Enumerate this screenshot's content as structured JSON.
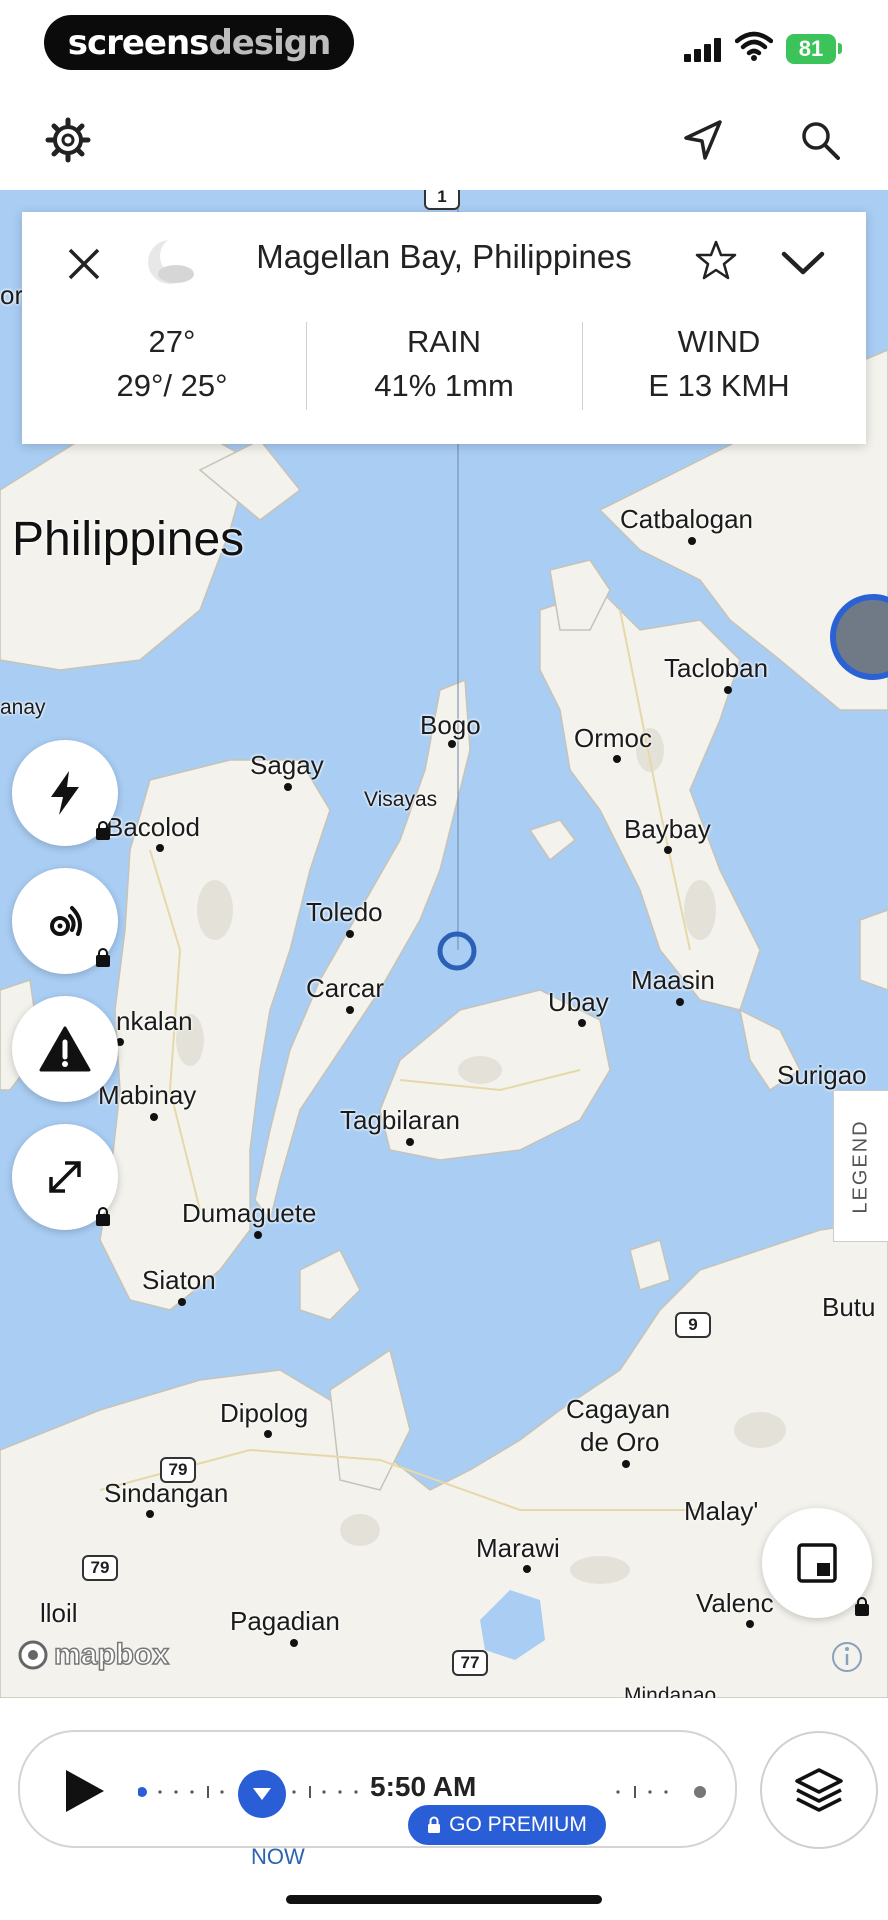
{
  "status_bar": {
    "brand_part1": "screens",
    "brand_part2": "design",
    "battery": "81"
  },
  "header": {
    "settings_icon": "gear-icon",
    "location_icon": "navigation-arrow-icon",
    "search_icon": "search-icon"
  },
  "card": {
    "title": "Magellan Bay, Philippines",
    "temp_current": "27°",
    "temp_range": "29°/ 25°",
    "rain_label": "RAIN",
    "rain_value": "41% 1mm",
    "wind_label": "WIND",
    "wind_value": "E 13 KMH"
  },
  "map": {
    "country_label": "Philippines",
    "places": {
      "catbalogan": "Catbalogan",
      "tacloban": "Tacloban",
      "ormoc": "Ormoc",
      "bogo": "Bogo",
      "sagay": "Sagay",
      "visayas": "Visayas",
      "bacolod": "Bacolod",
      "baybay": "Baybay",
      "toledo": "Toledo",
      "carcar": "Carcar",
      "maasin": "Maasin",
      "ubay": "Ubay",
      "kabankalan": "nkalan",
      "surigao": "Surigao",
      "mabinay": "Mabinay",
      "tagbilaran": "Tagbilaran",
      "dumaguete": "Dumaguete",
      "siaton": "Siaton",
      "butuan": "Butu",
      "dipolog": "Dipolog",
      "cagayan": "Cagayan",
      "de_oro": "de Oro",
      "sindangan": "Sindangan",
      "malaybalay": "Malay'",
      "marawi": "Marawi",
      "valencia": "Valenc",
      "iloilo_partial": "lloil",
      "pagadian": "Pagadian",
      "antique_partial": "anay",
      "left_edge_partial": "or",
      "mindanao": "Mindanao"
    },
    "road_shields": [
      "1",
      "9",
      "79",
      "79",
      "77"
    ],
    "attribution": "mapbox",
    "legend_label": "LEGEND"
  },
  "timeline": {
    "time": "5:50 AM",
    "now_label": "NOW",
    "premium_label": "GO PREMIUM"
  },
  "colors": {
    "water": "#a9cdf3",
    "land": "#f3f2ec",
    "accent": "#2a5ed6",
    "battery": "#3cc35a"
  }
}
